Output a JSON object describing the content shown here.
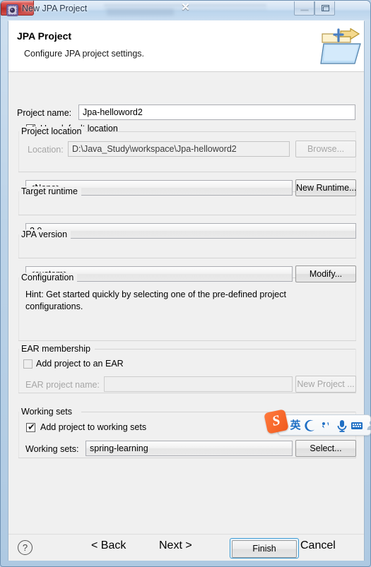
{
  "window": {
    "title": "New JPA Project",
    "app_icon": "eclipse-wizard-icon",
    "controls": {
      "minimize": "minimize-icon",
      "maximize": "maximize-icon",
      "close": "✕"
    }
  },
  "header": {
    "title": "JPA Project",
    "subtitle": "Configure JPA project settings.",
    "icon": "jpa-project-folder-icon"
  },
  "form": {
    "project_name": {
      "label": "Project name:",
      "value": "Jpa-helloword2",
      "placeholder": ""
    },
    "project_location": {
      "group_label": "Project location",
      "use_default": {
        "label": "Use default location",
        "checked": true,
        "enabled": true
      },
      "location": {
        "label": "Location:",
        "value": "D:\\Java_Study\\workspace\\Jpa-helloword2",
        "enabled": false
      },
      "browse_button": {
        "label": "Browse...",
        "enabled": false
      }
    },
    "target_runtime": {
      "group_label": "Target runtime",
      "selected": "<None>",
      "new_runtime_button": "New Runtime..."
    },
    "jpa_version": {
      "group_label": "JPA version",
      "selected": "2.0"
    },
    "configuration": {
      "group_label": "Configuration",
      "selected": "<custom>",
      "modify_button": "Modify...",
      "hint": "Hint: Get started quickly by selecting one of the pre-defined project configurations."
    },
    "ear_membership": {
      "group_label": "EAR membership",
      "add_to_ear": {
        "label": "Add project to an EAR",
        "checked": false,
        "enabled": false
      },
      "ear_project_name": {
        "label": "EAR project name:",
        "value": "",
        "enabled": false
      },
      "new_project_button": {
        "label": "New Project ...",
        "enabled": false
      }
    },
    "working_sets": {
      "group_label": "Working sets",
      "add_to_working_sets": {
        "label": "Add project to working sets",
        "checked": true,
        "enabled": true
      },
      "working_sets_field": {
        "label": "Working sets:",
        "value": "spring-learning"
      },
      "select_button": {
        "label": "Select...",
        "enabled": true
      }
    }
  },
  "button_bar": {
    "help": "?",
    "back": "< Back",
    "next": "Next >",
    "finish": "Finish",
    "cancel": "Cancel",
    "focused": "finish"
  },
  "ime_toolbar": {
    "logo": "sogou-logo",
    "items": [
      {
        "name": "language-mode",
        "glyph": "英"
      },
      {
        "name": "moon-mode",
        "glyph": "☽"
      },
      {
        "name": "punctuation-mode",
        "glyph": "‚'"
      },
      {
        "name": "voice-input",
        "glyph": "microphone-icon"
      },
      {
        "name": "soft-keyboard",
        "glyph": "keyboard-icon"
      },
      {
        "name": "user-menu",
        "glyph": "user-icon"
      }
    ]
  },
  "colors": {
    "accent_blue": "#3c9bd4",
    "close_red": "#c0322e",
    "dialog_bg": "#f0f0f0",
    "header_bg": "#ffffff",
    "ime_blue": "#1f6fc4",
    "sogou_orange": "#f05a1e"
  }
}
